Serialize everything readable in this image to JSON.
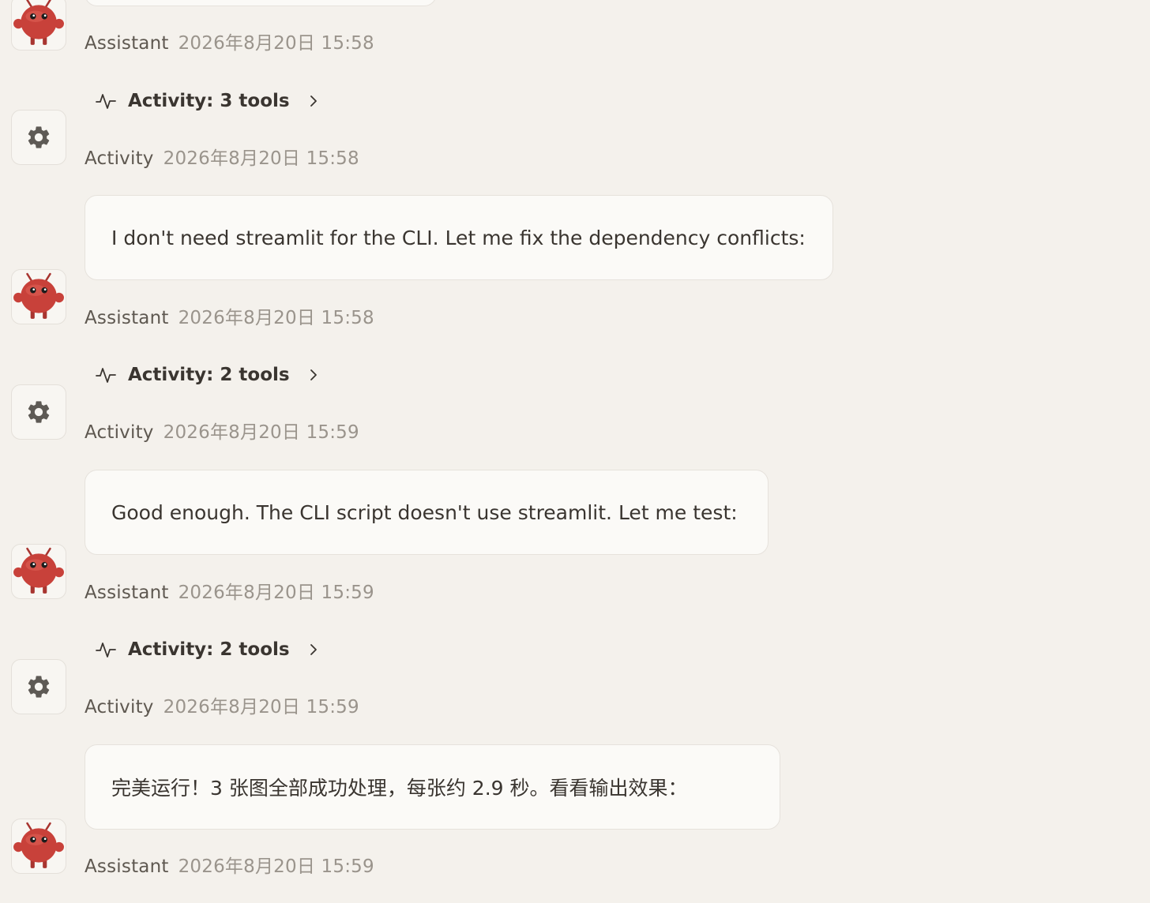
{
  "colors": {
    "background": "#f4f1ec",
    "bubble": "#fbfaf7",
    "assistant_avatar": "#c8413a",
    "gear_icon": "#5e5a55"
  },
  "icons": {
    "assistant": "red-robot-mascot-icon",
    "activity": "gear-icon",
    "activity_row": "pulse-line-icon",
    "expand": "chevron-right-icon"
  },
  "messages": [
    {
      "type": "assistant",
      "sender": "Assistant",
      "time": "2026年8月20日 15:58"
    },
    {
      "type": "activity",
      "label": "Activity: 3 tools",
      "sender": "Activity",
      "time": "2026年8月20日 15:58"
    },
    {
      "type": "assistant",
      "text": "I don't need streamlit for the CLI. Let me fix the dependency conflicts:",
      "sender": "Assistant",
      "time": "2026年8月20日 15:58"
    },
    {
      "type": "activity",
      "label": "Activity: 2 tools",
      "sender": "Activity",
      "time": "2026年8月20日 15:59"
    },
    {
      "type": "assistant",
      "text": "Good enough. The CLI script doesn't use streamlit. Let me test:",
      "sender": "Assistant",
      "time": "2026年8月20日 15:59"
    },
    {
      "type": "activity",
      "label": "Activity: 2 tools",
      "sender": "Activity",
      "time": "2026年8月20日 15:59"
    },
    {
      "type": "assistant",
      "text": "完美运行！3 张图全部成功处理，每张约 2.9 秒。看看输出效果：",
      "sender": "Assistant",
      "time": "2026年8月20日 15:59"
    }
  ]
}
